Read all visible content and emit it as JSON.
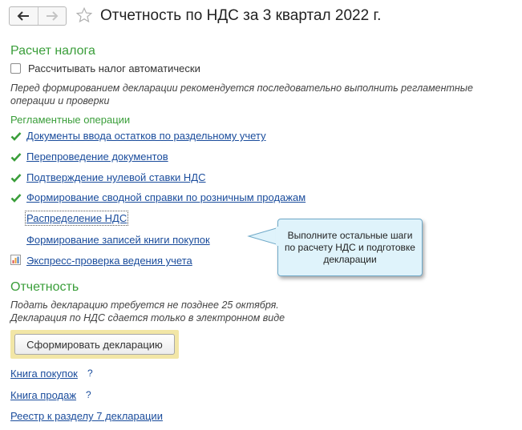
{
  "header": {
    "title": "Отчетность по НДС за 3 квартал 2022 г.",
    "back_icon": "arrow-left-icon",
    "forward_icon": "arrow-right-icon",
    "favorite_icon": "star-icon"
  },
  "tax_calc": {
    "heading": "Расчет налога",
    "auto_checkbox": {
      "label": "Рассчитывать налог автоматически",
      "checked": false
    },
    "note": "Перед формированием декларации рекомендуется последовательно выполнить регламентные операции и проверки"
  },
  "operations": {
    "heading": "Регламентные операции",
    "items": [
      {
        "label": "Документы ввода остатков по раздельному учету",
        "status": "done"
      },
      {
        "label": "Перепроведение документов",
        "status": "done"
      },
      {
        "label": "Подтверждение нулевой ставки НДС",
        "status": "done"
      },
      {
        "label": "Формирование сводной справки по розничным продажам",
        "status": "done"
      },
      {
        "label": "Распределение НДС",
        "status": "pending"
      },
      {
        "label": "Формирование записей книги покупок",
        "status": "pending"
      },
      {
        "label": "Экспресс-проверка ведения учета",
        "status": "report"
      }
    ]
  },
  "tooltip": {
    "text": "Выполните остальные шаги по расчету НДС и подготовке декларации"
  },
  "reporting": {
    "heading": "Отчетность",
    "note_line1": "Подать декларацию требуется не позднее 25 октября.",
    "note_line2": "Декларация по НДС сдается только в электронном виде",
    "button_label": "Сформировать декларацию"
  },
  "books": {
    "purchases": {
      "label": "Книга покупок",
      "help": "?"
    },
    "sales": {
      "label": "Книга продаж",
      "help": "?"
    },
    "registry": {
      "label": "Реестр к разделу 7 декларации"
    }
  },
  "colors": {
    "accent_green": "#3a9e3a",
    "link_blue": "#1a4c9c",
    "button_highlight": "#f2e6a6",
    "tooltip_bg": "#dff3fb"
  }
}
